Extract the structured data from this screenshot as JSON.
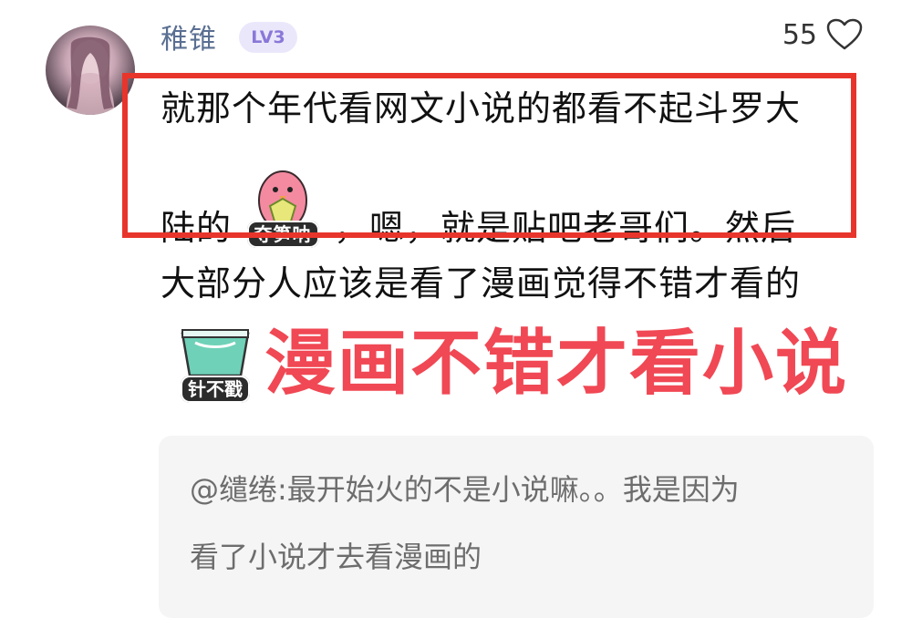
{
  "comment": {
    "username": "稚锥",
    "level": "LV3",
    "likes": "55",
    "text_line1": "就那个年代看网文小说的都看不起斗罗大",
    "text_line2_prefix": "陆的",
    "text_line2_suffix": "，嗯，就是贴吧老哥们。然后",
    "text_line3": "大部分人应该是看了漫画觉得不错才看的",
    "sticker1_label": "夺笋呐",
    "sticker2_label": "针不戳",
    "emphasis_text": "漫画不错才看小说",
    "quote_line1": "@缱绻:最开始火的不是小说嘛。。我是因为",
    "quote_line2": "看了小说才去看漫画的"
  },
  "colors": {
    "username": "#5a6f92",
    "level_badge_bg": "#ebe7fb",
    "level_badge_text": "#8a78d8",
    "highlight_border": "#e8352b",
    "emphasis": "#f04854",
    "quote_bg": "#f5f5f5",
    "quote_text": "#6d6d6d"
  },
  "icons": [
    "heart-outline-icon",
    "avatar-image",
    "sticker-penguin",
    "sticker-cup"
  ]
}
